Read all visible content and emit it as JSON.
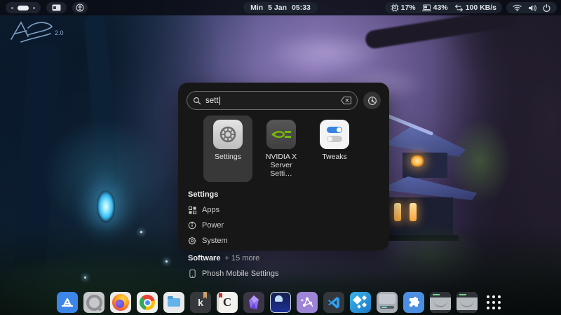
{
  "topbar": {
    "clock": {
      "day": "Min",
      "date": "5 Jan",
      "time": "05:33"
    },
    "stats": {
      "cpu": "17%",
      "memory": "43%",
      "network": "100 KB/s"
    },
    "left_icons": [
      "workspace-indicator",
      "keyboard-icon",
      "accessibility-icon"
    ],
    "quick_icons": [
      "wifi-icon",
      "volume-icon",
      "power-icon"
    ]
  },
  "wallpaper": {
    "signature": "2.0"
  },
  "launcher": {
    "search": {
      "value": "sett"
    },
    "results": [
      {
        "label": "Settings",
        "selected": true
      },
      {
        "label": "NVIDIA X Server Setti…",
        "selected": false
      },
      {
        "label": "Tweaks",
        "selected": false
      }
    ],
    "sections": [
      {
        "title": "Settings",
        "items": [
          {
            "label": "Apps",
            "icon": "apps-grid-icon"
          },
          {
            "label": "Power",
            "icon": "power-gauge-icon"
          },
          {
            "label": "System",
            "icon": "gear-icon"
          }
        ]
      },
      {
        "title": "Software",
        "more": "+ 15 more",
        "items": [
          {
            "label": "Phosh Mobile Settings",
            "icon": "phone-icon"
          }
        ]
      }
    ]
  },
  "dock": {
    "items": [
      "app-store",
      "q-viewer",
      "firefox",
      "chrome",
      "files",
      "k-reader",
      "calibre",
      "obsidian",
      "ghost-terminal",
      "molecule-app",
      "vscode",
      "kodi",
      "drive-utility",
      "extensions",
      "external-drive-1",
      "external-drive-2",
      "app-grid"
    ]
  },
  "colors": {
    "accent": "#3584e4",
    "panel_bg": "#171717",
    "selection": "#383838",
    "nvidia_green": "#76b900",
    "window_glow": "#ffb649"
  }
}
